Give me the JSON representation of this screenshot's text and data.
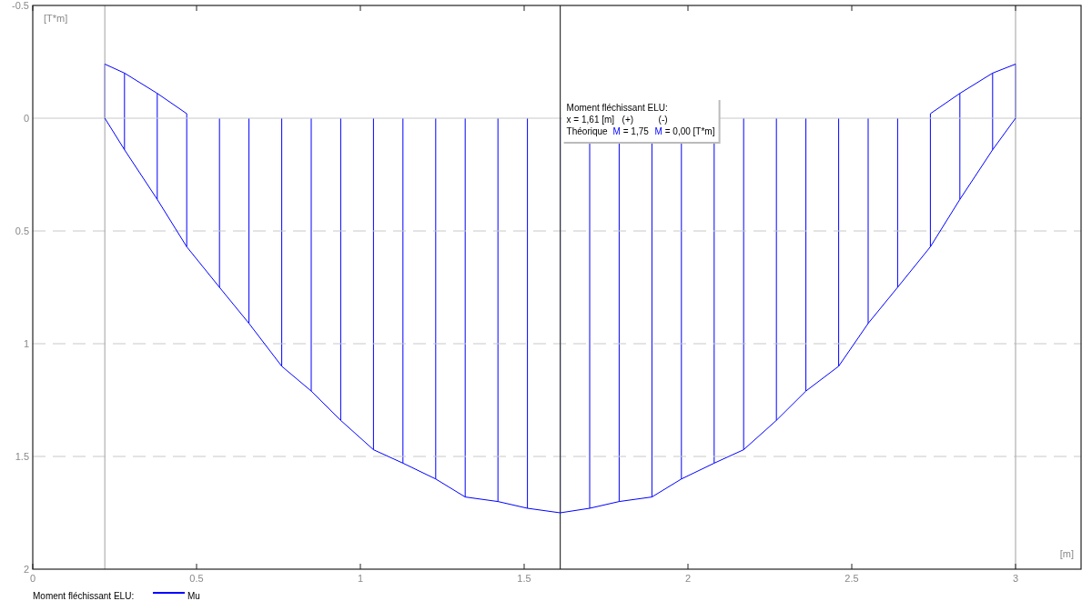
{
  "chart": {
    "chart_data": {
      "type": "line",
      "ylabel": "[T*m]",
      "xlabel": "[m]",
      "x": [
        0.22,
        0.28,
        0.38,
        0.47,
        0.57,
        0.66,
        0.76,
        0.85,
        0.94,
        1.04,
        1.13,
        1.23,
        1.32,
        1.42,
        1.51,
        1.61,
        1.7,
        1.79,
        1.89,
        1.98,
        2.08,
        2.17,
        2.27,
        2.36,
        2.46,
        2.55,
        2.64,
        2.74,
        2.83,
        2.93,
        3.0
      ],
      "series": [
        {
          "name": "Mu",
          "color": "#0000ff",
          "values": [
            0,
            0.14,
            0.36,
            0.57,
            0.75,
            0.91,
            1.1,
            1.21,
            1.34,
            1.47,
            1.53,
            1.6,
            1.68,
            1.7,
            1.73,
            1.75,
            1.73,
            1.7,
            1.68,
            1.6,
            1.53,
            1.47,
            1.34,
            1.21,
            1.1,
            0.91,
            0.75,
            0.57,
            0.36,
            0.14,
            0
          ]
        },
        {
          "color": "#0000ff",
          "values": [
            -0.24,
            -0.2,
            -0.11,
            -0.02,
            null,
            null,
            null,
            null,
            null,
            null,
            null,
            null,
            null,
            null,
            null,
            null,
            null,
            null,
            null,
            null,
            null,
            null,
            null,
            null,
            null,
            null,
            null,
            -0.02,
            -0.11,
            -0.2,
            -0.24
          ]
        }
      ],
      "xlim": [
        0,
        3.2
      ],
      "ylim": [
        2,
        -0.5
      ],
      "xticks": [
        {
          "value": 0,
          "label": "0"
        },
        {
          "value": 0.5,
          "label": "0.5"
        },
        {
          "value": 1,
          "label": "1"
        },
        {
          "value": 1.5,
          "label": "1.5"
        },
        {
          "value": 2,
          "label": "2"
        },
        {
          "value": 2.5,
          "label": "2.5"
        },
        {
          "value": 3,
          "label": "3"
        }
      ],
      "yticks": [
        {
          "value": -0.5,
          "label": "-0.5"
        },
        {
          "value": 0,
          "label": "0"
        },
        {
          "value": 0.5,
          "label": "0.5"
        },
        {
          "value": 1,
          "label": "1"
        },
        {
          "value": 1.5,
          "label": "1.5"
        },
        {
          "value": 2,
          "label": "2"
        }
      ],
      "grid": true,
      "ref_lines": [
        {
          "axis": "x",
          "value": 0.22,
          "color": "#b0b0b0"
        },
        {
          "axis": "x",
          "value": 3.0,
          "color": "#b0b0b0"
        },
        {
          "axis": "x",
          "value": 1.61,
          "color": "#333333"
        }
      ]
    },
    "legend": {
      "label": "Moment fléchissant ELU:"
    }
  },
  "tooltip": {
    "title": "Moment fléchissant ELU:",
    "position": "x = 1,61 [m]",
    "plus": "(+)",
    "minus": "(-)",
    "row_label": "Théorique",
    "values": [
      {
        "symbol": "M",
        "text": "= 1,75"
      },
      {
        "symbol": "M",
        "text": "= 0,00 [T*m]"
      }
    ]
  }
}
